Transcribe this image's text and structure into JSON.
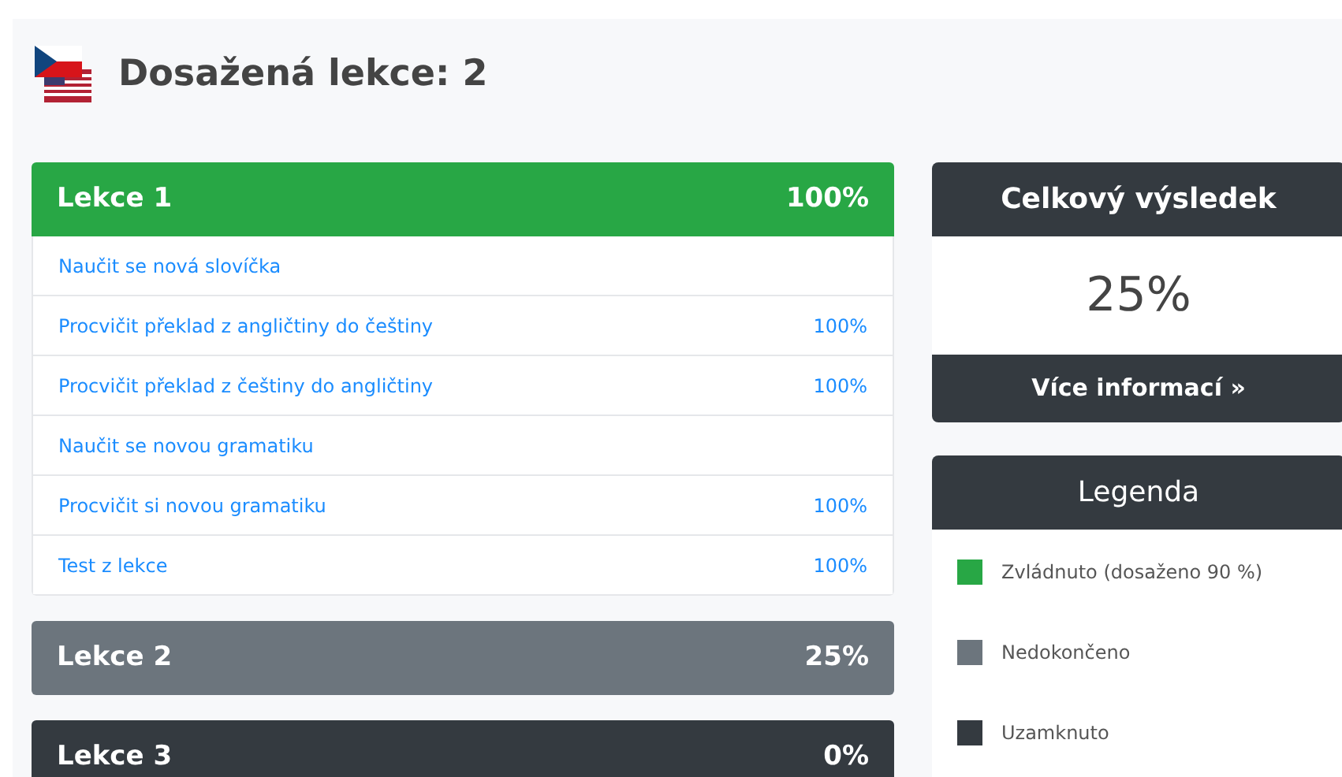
{
  "heading": "Dosažená lekce: 2",
  "lessons": [
    {
      "title": "Lekce 1",
      "percent": "100%",
      "color": "#28a745",
      "tasks": [
        {
          "label": "Naučit se nová slovíčka"
        },
        {
          "label": "Procvičit překlad z angličtiny do češtiny",
          "percent": "100%"
        },
        {
          "label": "Procvičit překlad z češtiny do angličtiny",
          "percent": "100%"
        },
        {
          "label": "Naučit se novou gramatiku"
        },
        {
          "label": "Procvičit si novou gramatiku",
          "percent": "100%"
        },
        {
          "label": "Test z lekce",
          "percent": "100%"
        }
      ]
    },
    {
      "title": "Lekce 2",
      "percent": "25%",
      "color": "#6c757d"
    },
    {
      "title": "Lekce 3",
      "percent": "0%",
      "color": "#343a40"
    }
  ],
  "overall": {
    "title": "Celkový výsledek",
    "value": "25%",
    "button": "Více informací »"
  },
  "legend": {
    "title": "Legenda",
    "items": [
      {
        "label": "Zvládnuto (dosaženo 90 %)",
        "color": "#28a745"
      },
      {
        "label": "Nedokončeno",
        "color": "#6c757d"
      },
      {
        "label": "Uzamknuto",
        "color": "#343a40"
      }
    ]
  }
}
